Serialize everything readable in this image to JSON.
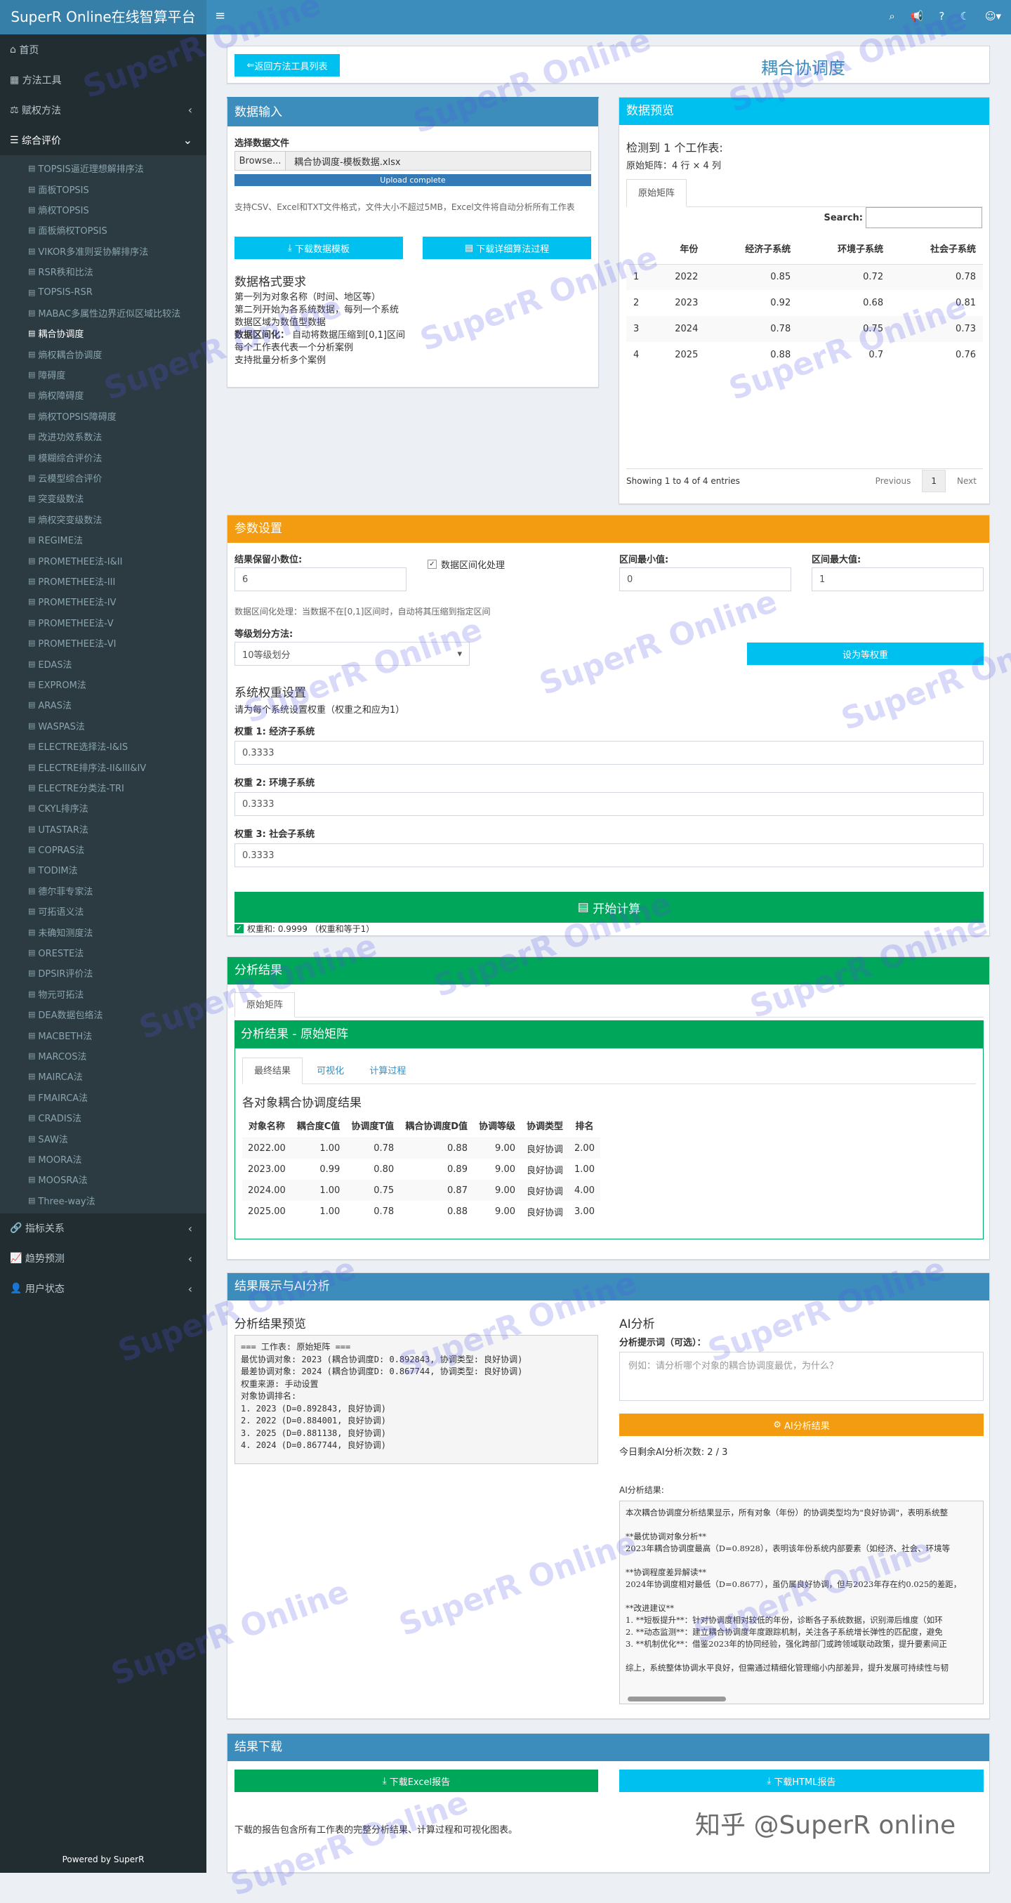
{
  "app": {
    "title": "SuperR Online在线智算平台",
    "footer": "Powered by SuperR"
  },
  "sidebar": {
    "top": [
      {
        "label": "首页",
        "icon": "home-icon"
      },
      {
        "label": "方法工具",
        "icon": "table-icon"
      },
      {
        "label": "赋权方法",
        "icon": "balance-icon"
      },
      {
        "label": "综合评价",
        "icon": "list-icon"
      }
    ],
    "items": [
      "TOPSIS逼近理想解排序法",
      "面板TOPSIS",
      "熵权TOPSIS",
      "面板熵权TOPSIS",
      "VIKOR多准则妥协解排序法",
      "RSR秩和比法",
      "TOPSIS-RSR",
      "MABAC多属性边界近似区域比较法",
      "耦合协调度",
      "熵权耦合协调度",
      "障碍度",
      "熵权障碍度",
      "熵权TOPSIS障碍度",
      "改进功效系数法",
      "模糊综合评价法",
      "云模型综合评价",
      "突变级数法",
      "熵权突变级数法",
      "REGIME法",
      "PROMETHEE法-I&II",
      "PROMETHEE法-III",
      "PROMETHEE法-IV",
      "PROMETHEE法-V",
      "PROMETHEE法-VI",
      "EDAS法",
      "EXPROM法",
      "ARAS法",
      "WASPAS法",
      "ELECTRE选择法-I&IS",
      "ELECTRE排序法-II&III&IV",
      "ELECTRE分类法-TRI",
      "CKYL排序法",
      "UTASTAR法",
      "COPRAS法",
      "TODIM法",
      "德尔菲专家法",
      "可拓语义法",
      "未确知测度法",
      "ORESTE法",
      "DPSIR评价法",
      "物元可拓法",
      "DEA数据包络法",
      "MACBETH法",
      "MARCOS法",
      "MAIRCA法",
      "FMAIRCA法",
      "CRADIS法",
      "SAW法",
      "MOORA法",
      "MOOSRA法",
      "Three-way法"
    ],
    "bottom": [
      {
        "label": "指标关系",
        "icon": "link-icon"
      },
      {
        "label": "趋势预测",
        "icon": "chart-icon"
      },
      {
        "label": "用户状态",
        "icon": "user-icon"
      }
    ]
  },
  "header": {
    "back": "返回方法工具列表",
    "title": "耦合协调度"
  },
  "input": {
    "title": "数据输入",
    "file_label": "选择数据文件",
    "browse": "Browse...",
    "filename": "耦合协调度-模板数据.xlsx",
    "progress": "Upload complete",
    "desc": "支持CSV、Excel和TXT文件格式，文件大小不超过5MB，Excel文件将自动分析所有工作表",
    "btn_template": "下载数据模板",
    "btn_detail": "下载详细算法过程",
    "fmt_title": "数据格式要求",
    "fmt_lines": [
      "第一列为对象名称（时间、地区等）",
      "第二列开始为各系统数据，每列一个系统",
      "数据区域为数值型数据"
    ],
    "fmt_bold": "数据区间化：",
    "fmt_bold_rest": "自动将数据压缩到[0,1]区间",
    "fmt_lines2": [
      "每个工作表代表一个分析案例",
      "支持批量分析多个案例"
    ]
  },
  "preview": {
    "title": "数据预览",
    "detected": "检测到 1 个工作表:",
    "matrix": "原始矩阵：4 行 × 4 列",
    "tab": "原始矩阵",
    "search": "Search:",
    "columns": [
      "",
      "年份",
      "经济子系统",
      "环境子系统",
      "社会子系统"
    ],
    "rows": [
      [
        "1",
        "2022",
        "0.85",
        "0.72",
        "0.78"
      ],
      [
        "2",
        "2023",
        "0.92",
        "0.68",
        "0.81"
      ],
      [
        "3",
        "2024",
        "0.78",
        "0.75",
        "0.73"
      ],
      [
        "4",
        "2025",
        "0.88",
        "0.7",
        "0.76"
      ]
    ],
    "showing": "Showing 1 to 4 of 4 entries",
    "prev": "Previous",
    "page": "1",
    "next": "Next"
  },
  "params": {
    "title": "参数设置",
    "decimals_label": "结果保留小数位:",
    "decimals": "6",
    "normalize": "数据区间化处理",
    "min_label": "区间最小值:",
    "min": "0",
    "max_label": "区间最大值:",
    "max": "1",
    "hint": "数据区间化处理：当数据不在[0,1]区间时，自动将其压缩到指定区间",
    "grade_label": "等级划分方法:",
    "grade": "10等级划分",
    "equal_btn": "设为等权重",
    "weight_title": "系统权重设置",
    "weight_hint": "请为每个系统设置权重（权重之和应为1）",
    "weights": [
      {
        "label": "权重 1: 经济子系统",
        "value": "0.3333"
      },
      {
        "label": "权重 2: 环境子系统",
        "value": "0.3333"
      },
      {
        "label": "权重 3: 社会子系统",
        "value": "0.3333"
      }
    ],
    "start": "开始计算",
    "sum": "权重和: 0.9999 （权重和等于1）"
  },
  "results": {
    "title": "分析结果",
    "tab": "原始矩阵",
    "inner_title": "分析结果 - 原始矩阵",
    "tabs": [
      "最终结果",
      "可视化",
      "计算过程"
    ],
    "table_title": "各对象耦合协调度结果",
    "columns": [
      "对象名称",
      "耦合度C值",
      "协调度T值",
      "耦合协调度D值",
      "协调等级",
      "协调类型",
      "排名"
    ],
    "rows": [
      [
        "2022.00",
        "1.00",
        "0.78",
        "0.88",
        "9.00",
        "良好协调",
        "2.00"
      ],
      [
        "2023.00",
        "0.99",
        "0.80",
        "0.89",
        "9.00",
        "良好协调",
        "1.00"
      ],
      [
        "2024.00",
        "1.00",
        "0.75",
        "0.87",
        "9.00",
        "良好协调",
        "4.00"
      ],
      [
        "2025.00",
        "1.00",
        "0.78",
        "0.88",
        "9.00",
        "良好协调",
        "3.00"
      ]
    ]
  },
  "ai": {
    "title": "结果展示与AI分析",
    "preview_title": "分析结果预览",
    "preview_text": "=== 工作表: 原始矩阵 ===\n最优协调对象: 2023 (耦合协调度D: 0.892843, 协调类型: 良好协调)\n最差协调对象: 2024 (耦合协调度D: 0.867744, 协调类型: 良好协调)\n权重来源: 手动设置\n对象协调排名:\n1. 2023 (D=0.892843, 良好协调)\n2. 2022 (D=0.884001, 良好协调)\n3. 2025 (D=0.881138, 良好协调)\n4. 2024 (D=0.867744, 良好协调)",
    "ai_title": "AI分析",
    "prompt_label": "分析提示词（可选）：",
    "prompt_ph": "例如：请分析哪个对象的耦合协调度最优，为什么？",
    "ai_btn": "AI分析结果",
    "remain": "今日剩余AI分析次数: 2 / 3",
    "result_label": "AI分析结果:",
    "result_text": "本次耦合协调度分析结果显示，所有对象（年份）的协调类型均为\"良好协调\"，表明系统整\n\n**最优协调对象分析**\n2023年耦合协调度最高（D=0.8928），表明该年份系统内部要素（如经济、社会、环境等\n\n**协调程度差异解读**\n2024年协调度相对最低（D=0.8677），虽仍属良好协调，但与2023年存在约0.025的差距，\n\n**改进建议**\n1. **短板提升**：针对协调度相对较低的年份，诊断各子系统数据，识别滞后维度（如环\n2. **动态监测**：建立耦合协调度年度跟踪机制，关注各子系统增长弹性的匹配度，避免\n3. **机制优化**：借鉴2023年的协同经验，强化跨部门或跨领域联动政策，提升要素间正\n\n综上，系统整体协调水平良好，但需通过精细化管理缩小内部差异，提升发展可持续性与韧"
  },
  "download": {
    "title": "结果下载",
    "excel": "下载Excel报告",
    "html": "下载HTML报告",
    "desc": "下载的报告包含所有工作表的完整分析结果、计算过程和可视化图表。"
  },
  "watermark": {
    "text": "SuperR Online",
    "corner": "知乎 @SuperR online"
  },
  "colors": {
    "primary": "#3c8dbc",
    "cyan": "#00c0ef",
    "green": "#00a65a",
    "orange": "#f39c12",
    "sidebar": "#222d32"
  }
}
